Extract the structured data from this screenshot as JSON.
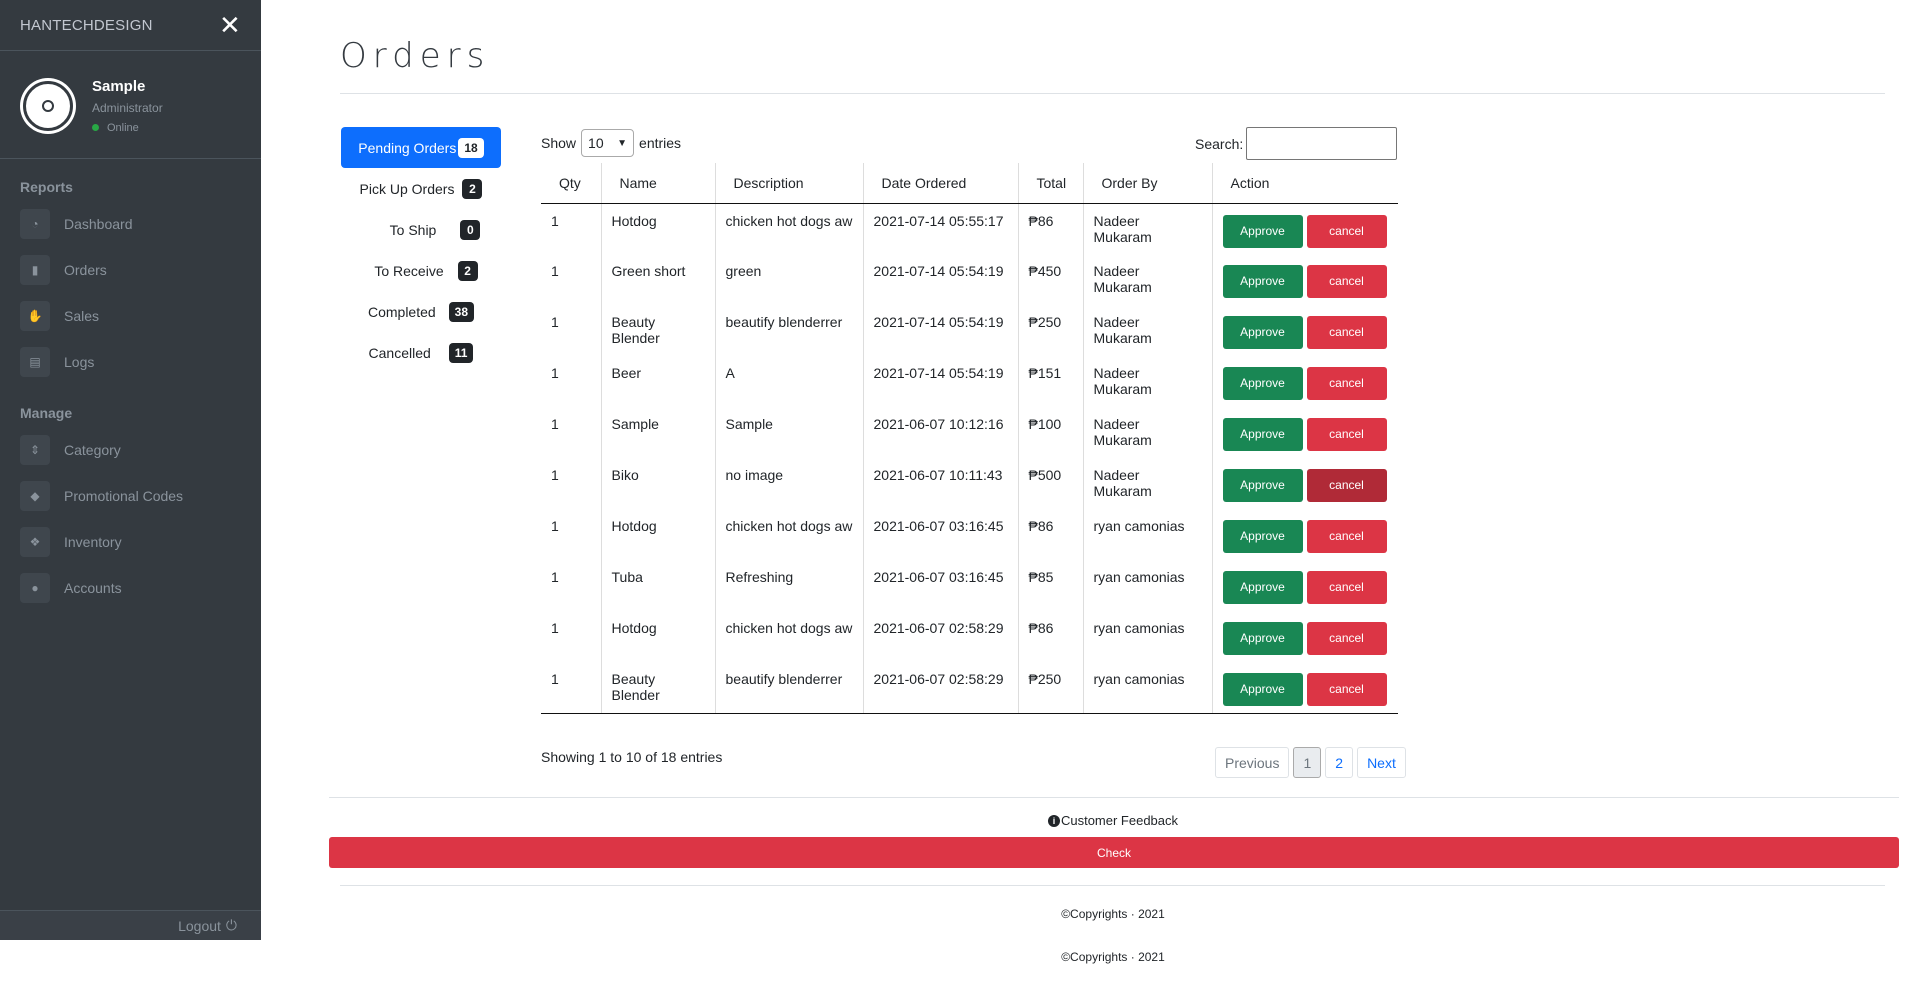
{
  "sidebar": {
    "brand": "HANTECHDESIGN",
    "user": {
      "name": "Sample",
      "role": "Administrator",
      "status": "Online"
    },
    "sections": [
      {
        "header": "Reports",
        "items": [
          {
            "label": "Dashboard",
            "icon": "dashboard-icon"
          },
          {
            "label": "Orders",
            "icon": "clipboard-icon"
          },
          {
            "label": "Sales",
            "icon": "hand-coin-icon"
          },
          {
            "label": "Logs",
            "icon": "clipboard-list-icon"
          }
        ]
      },
      {
        "header": "Manage",
        "items": [
          {
            "label": "Category",
            "icon": "sort-icon"
          },
          {
            "label": "Promotional Codes",
            "icon": "tags-icon"
          },
          {
            "label": "Inventory",
            "icon": "dropbox-icon"
          },
          {
            "label": "Accounts",
            "icon": "users-icon"
          }
        ]
      }
    ],
    "logout": "Logout"
  },
  "page": {
    "title": "Orders"
  },
  "status_tabs": [
    {
      "label": "Pending Orders",
      "count": "18",
      "active": true
    },
    {
      "label": "Pick Up Orders",
      "count": "2"
    },
    {
      "label": "To Ship",
      "count": "0"
    },
    {
      "label": "To Receive",
      "count": "2"
    },
    {
      "label": "Completed",
      "count": "38"
    },
    {
      "label": "Cancelled",
      "count": "11"
    }
  ],
  "table_controls": {
    "show": "Show",
    "entries_value": "10",
    "entries": "entries",
    "search_label": "Search:",
    "search_value": ""
  },
  "table": {
    "columns": [
      "Qty",
      "Name",
      "Description",
      "Date Ordered",
      "Total",
      "Order By",
      "Action"
    ],
    "approve_label": "Approve",
    "cancel_label": "cancel",
    "rows": [
      [
        "1",
        "Hotdog",
        "chicken hot dogs aw",
        "2021-07-14 05:55:17",
        "₱86",
        "Nadeer Mukaram"
      ],
      [
        "1",
        "Green short",
        "green",
        "2021-07-14 05:54:19",
        "₱450",
        "Nadeer Mukaram"
      ],
      [
        "1",
        "Beauty Blender",
        "beautify blenderrer",
        "2021-07-14 05:54:19",
        "₱250",
        "Nadeer Mukaram"
      ],
      [
        "1",
        "Beer",
        "A",
        "2021-07-14 05:54:19",
        "₱151",
        "Nadeer Mukaram"
      ],
      [
        "1",
        "Sample",
        "Sample",
        "2021-06-07 10:12:16",
        "₱100",
        "Nadeer Mukaram"
      ],
      [
        "1",
        "Biko",
        "no image",
        "2021-06-07 10:11:43",
        "₱500",
        "Nadeer Mukaram"
      ],
      [
        "1",
        "Hotdog",
        "chicken hot dogs aw",
        "2021-06-07 03:16:45",
        "₱86",
        "ryan camonias"
      ],
      [
        "1",
        "Tuba",
        "Refreshing",
        "2021-06-07 03:16:45",
        "₱85",
        "ryan camonias"
      ],
      [
        "1",
        "Hotdog",
        "chicken hot dogs aw",
        "2021-06-07 02:58:29",
        "₱86",
        "ryan camonias"
      ],
      [
        "1",
        "Beauty Blender",
        "beautify blenderrer",
        "2021-06-07 02:58:29",
        "₱250",
        "ryan camonias"
      ]
    ]
  },
  "table_info": "Showing 1 to 10 of 18 entries",
  "pagination": {
    "previous": "Previous",
    "pages": [
      "1",
      "2"
    ],
    "next": "Next"
  },
  "feedback": {
    "label": "Customer Feedback",
    "button": "Check"
  },
  "footer": {
    "copyright_1": "©Copyrights · 2021",
    "copyright_2": "©Copyrights · 2021"
  },
  "colors": {
    "sidebar_bg": "#343a40",
    "primary": "#0d6efd",
    "success": "#198754",
    "danger": "#dc3545"
  }
}
